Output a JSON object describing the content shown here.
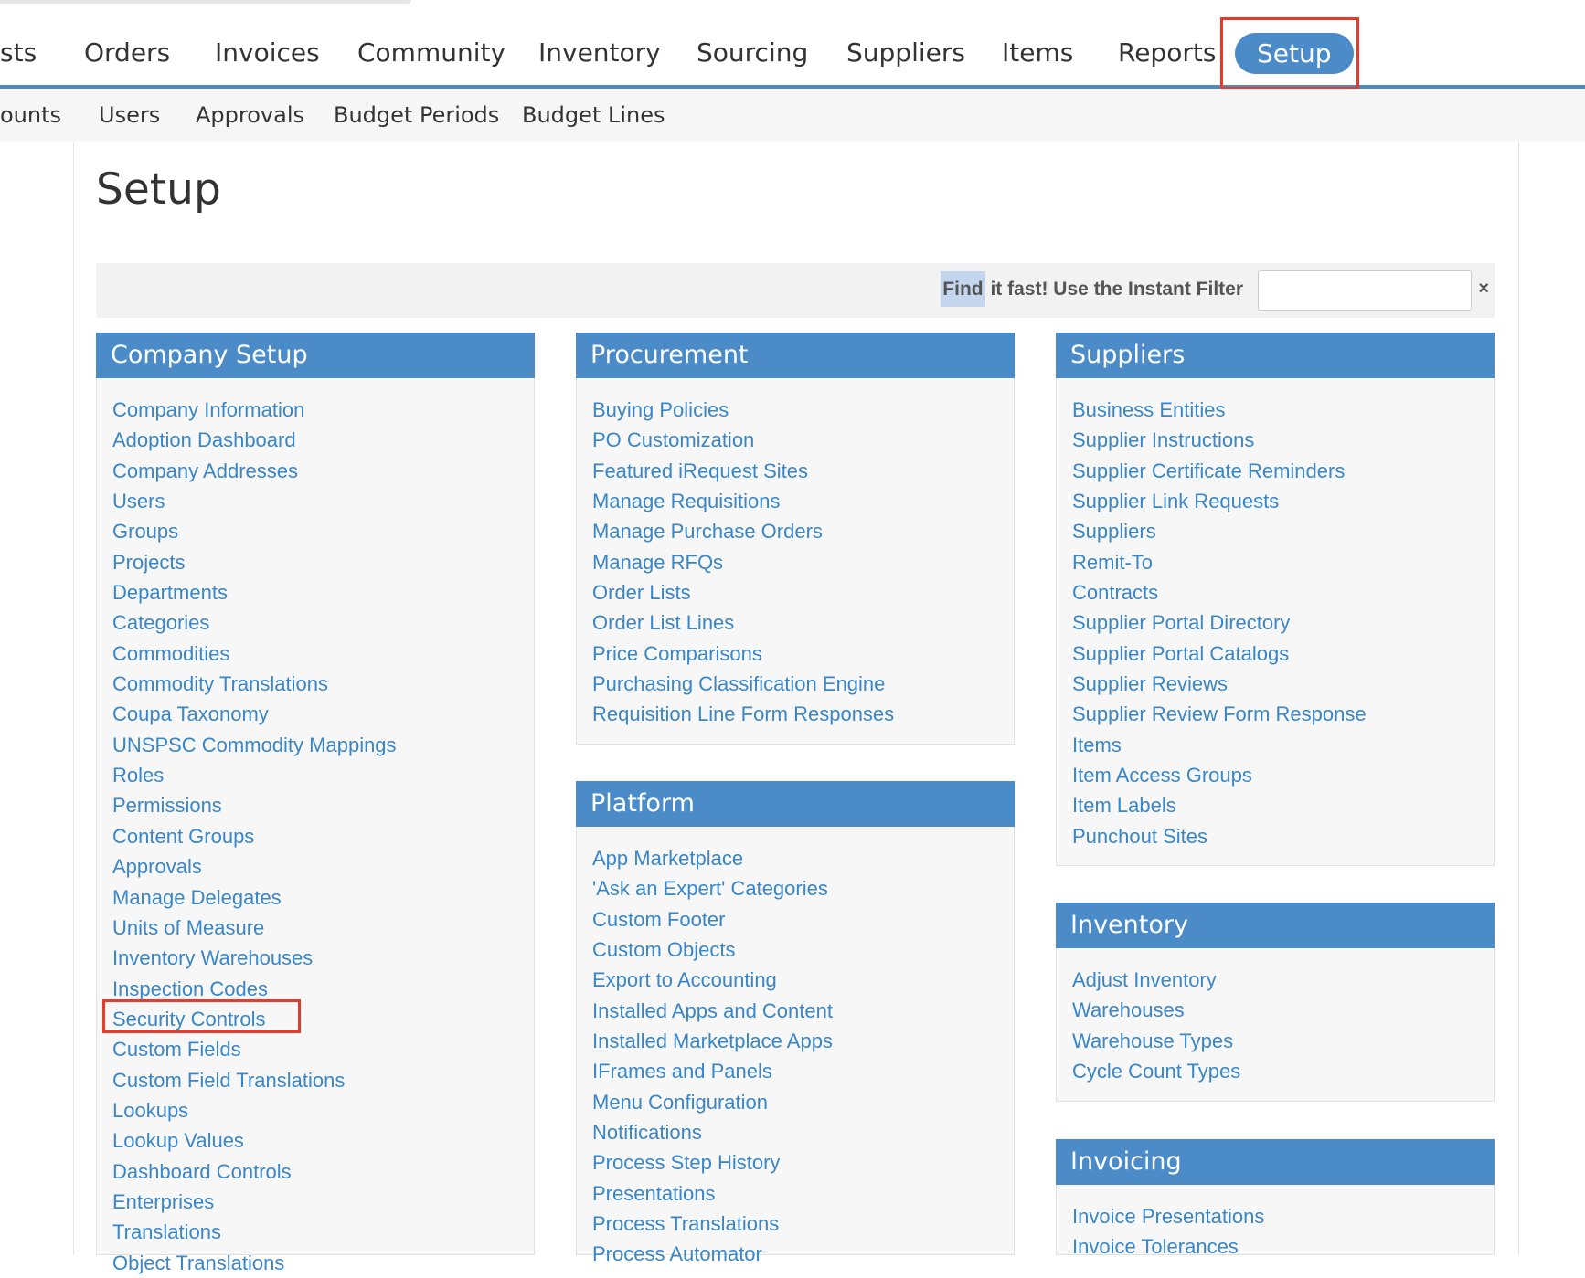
{
  "top_nav": {
    "items": [
      "sts",
      "Orders",
      "Invoices",
      "Community",
      "Inventory",
      "Sourcing",
      "Suppliers",
      "Items",
      "Reports"
    ],
    "active": "Setup"
  },
  "sub_nav": {
    "items": [
      "ounts",
      "Users",
      "Approvals",
      "Budget Periods",
      "Budget Lines"
    ]
  },
  "page": {
    "title": "Setup"
  },
  "filter": {
    "label_highlight": "Find",
    "label_rest": " it fast! Use the Instant Filter",
    "value": "",
    "clear": "×"
  },
  "panels": {
    "company_setup": {
      "title": "Company Setup",
      "links": [
        "Company Information",
        "Adoption Dashboard",
        "Company Addresses",
        "Users",
        "Groups",
        "Projects",
        "Departments",
        "Categories",
        "Commodities",
        "Commodity Translations",
        "Coupa Taxonomy",
        "UNSPSC Commodity Mappings",
        "Roles",
        "Permissions",
        "Content Groups",
        "Approvals",
        "Manage Delegates",
        "Units of Measure",
        "Inventory Warehouses",
        "Inspection Codes",
        "Security Controls",
        "Custom Fields",
        "Custom Field Translations",
        "Lookups",
        "Lookup Values",
        "Dashboard Controls",
        "Enterprises",
        "Translations",
        "Object Translations"
      ]
    },
    "procurement": {
      "title": "Procurement",
      "links": [
        "Buying Policies",
        "PO Customization",
        "Featured iRequest Sites",
        "Manage Requisitions",
        "Manage Purchase Orders",
        "Manage RFQs",
        "Order Lists",
        "Order List Lines",
        "Price Comparisons",
        "Purchasing Classification Engine",
        "Requisition Line Form Responses"
      ]
    },
    "platform": {
      "title": "Platform",
      "links": [
        "App Marketplace",
        "'Ask an Expert' Categories",
        "Custom Footer",
        "Custom Objects",
        "Export to Accounting",
        "Installed Apps and Content",
        "Installed Marketplace Apps",
        "IFrames and Panels",
        "Menu Configuration",
        "Notifications",
        "Process Step History",
        "Presentations",
        "Process Translations",
        "Process Automator"
      ]
    },
    "suppliers": {
      "title": "Suppliers",
      "links": [
        "Business Entities",
        "Supplier Instructions",
        "Supplier Certificate Reminders",
        "Supplier Link Requests",
        "Suppliers",
        "Remit-To",
        "Contracts",
        "Supplier Portal Directory",
        "Supplier Portal Catalogs",
        "Supplier Reviews",
        "Supplier Review Form Response",
        "Items",
        "Item Access Groups",
        "Item Labels",
        "Punchout Sites"
      ]
    },
    "inventory": {
      "title": "Inventory",
      "links": [
        "Adjust Inventory",
        "Warehouses",
        "Warehouse Types",
        "Cycle Count Types"
      ]
    },
    "invoicing": {
      "title": "Invoicing",
      "links": [
        "Invoice Presentations",
        "Invoice Tolerances"
      ]
    }
  },
  "colors": {
    "accent": "#4a8bc8",
    "link": "#3a86c6",
    "highlight_box": "#e53a2c"
  }
}
